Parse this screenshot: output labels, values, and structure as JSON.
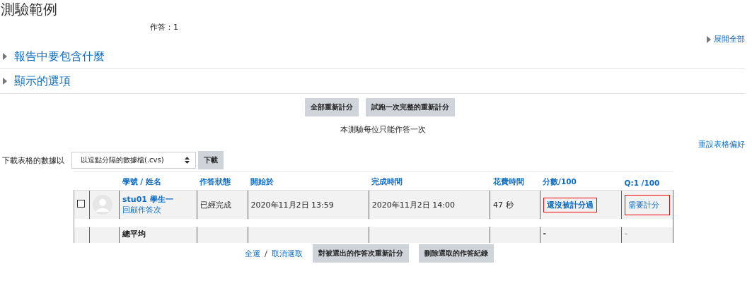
{
  "title": "測驗範例",
  "attempts": "作答：1",
  "expand_all": "展開全部",
  "sections": [
    {
      "label": "報告中要包含什麼",
      "expanded": false
    },
    {
      "label": "顯示的選項",
      "expanded": false
    }
  ],
  "regrade_buttons": [
    "全部重新計分",
    "試跑一次完整的重新計分"
  ],
  "notice": "本測驗每位只能作答一次",
  "reset_prefs": "重設表格偏好",
  "download": {
    "label": "下載表格的數據以",
    "format": "以逗點分隔的數據檔(.cvs)",
    "button": "下載"
  },
  "table": {
    "columns": [
      {
        "label": "學號 / 姓名"
      },
      {
        "label": "作答狀態"
      },
      {
        "label": "開始於"
      },
      {
        "label": "完成時間"
      },
      {
        "label": "花費時間"
      },
      {
        "label": "分數/100"
      },
      {
        "label": "Q:1 /100"
      }
    ],
    "rows": [
      {
        "kind": "attempt",
        "checked": false,
        "name": "stu01 學生一",
        "review": "回顧作答次",
        "status": "已經完成",
        "started": "2020年11月2日 13:59",
        "completed": "2020年11月2日 14:00",
        "duration": "47 秒",
        "grade": "還沒被計分過",
        "grade_highlighted": true,
        "q1": "需要計分",
        "q1_highlighted": true
      },
      {
        "kind": "spacer"
      },
      {
        "kind": "average",
        "name": "總平均",
        "grade": "-",
        "q1": "-"
      }
    ]
  },
  "select_all": "全選",
  "separator": "/",
  "deselect_all": "取消選取",
  "bottom_buttons": [
    "對被選出的作答次重新計分",
    "刪除選取的作答紀錄"
  ]
}
